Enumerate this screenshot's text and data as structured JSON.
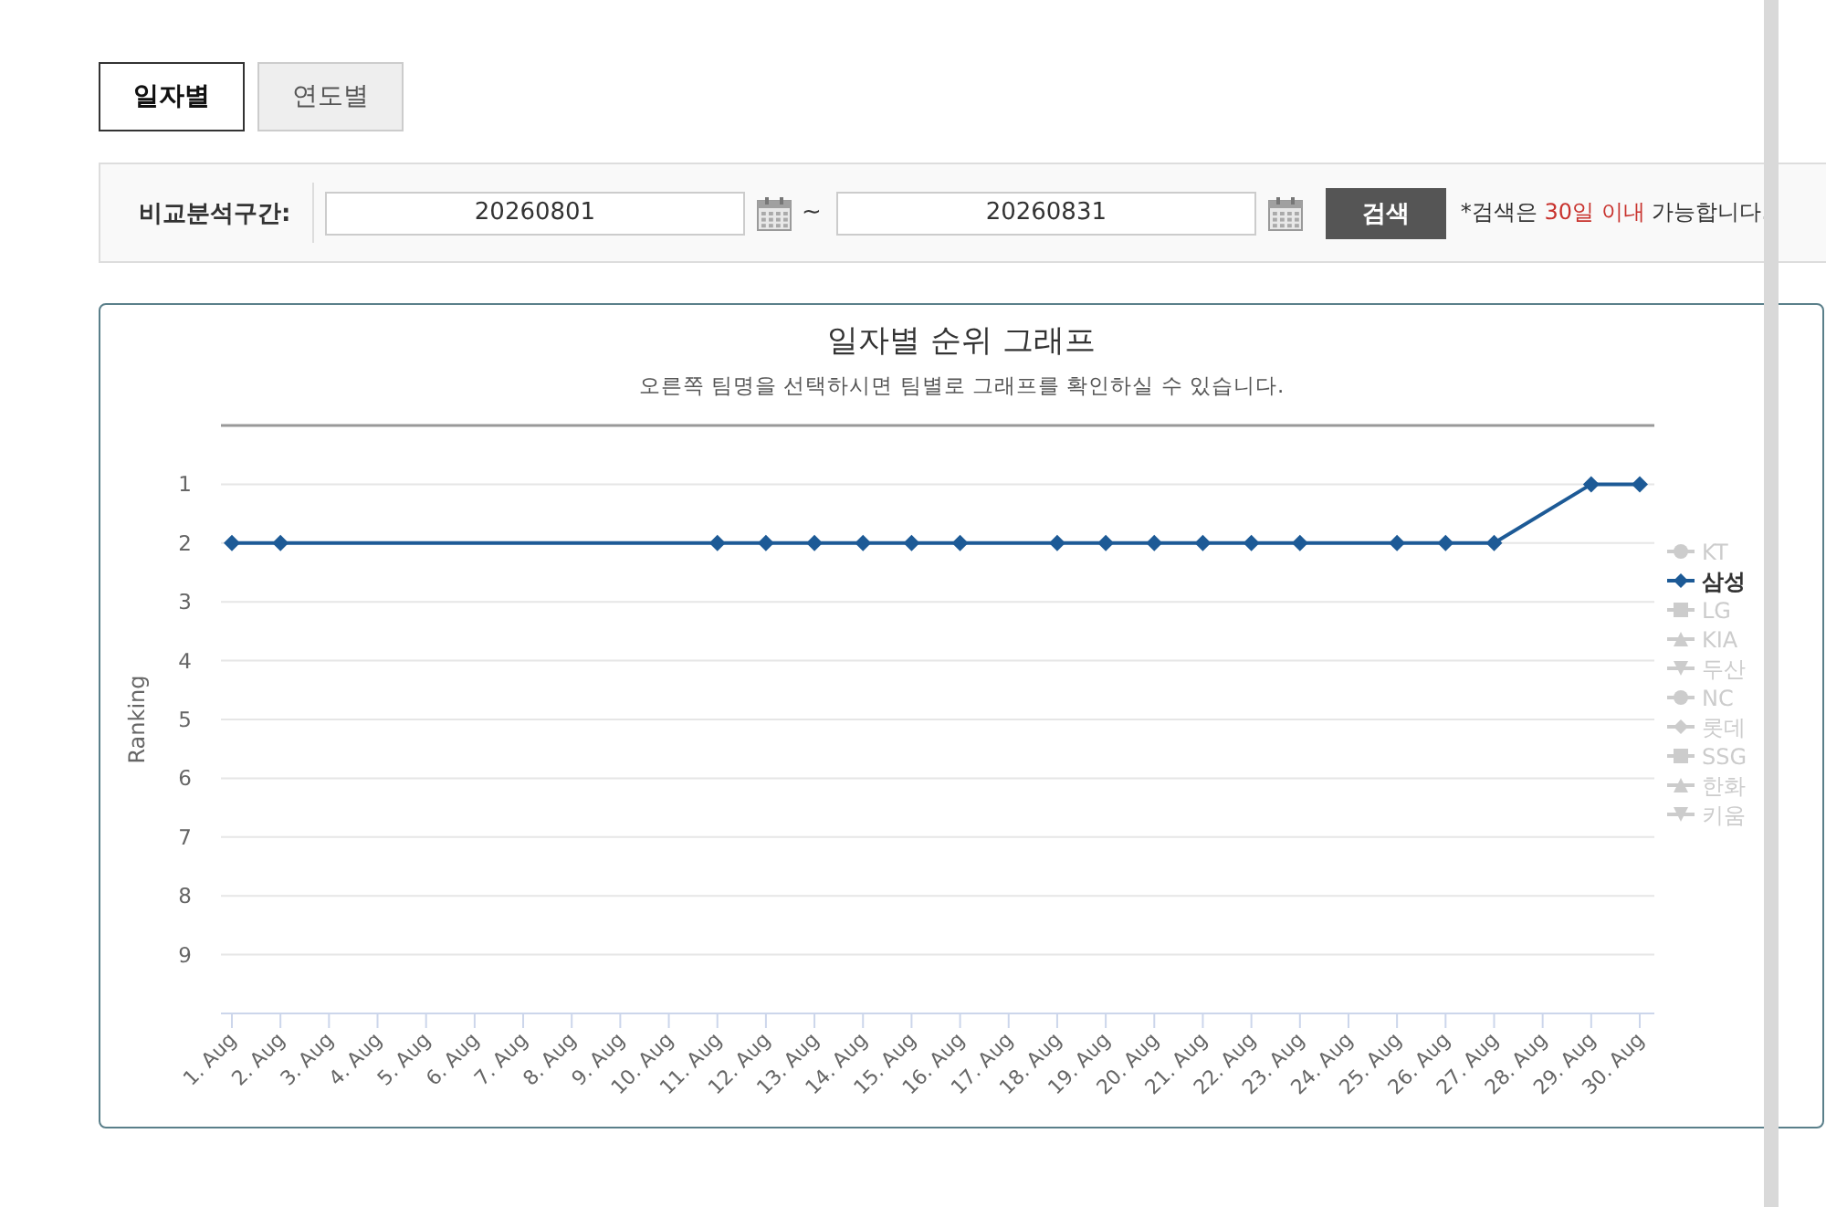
{
  "tabs": [
    {
      "label": "일자별",
      "selected": true
    },
    {
      "label": "연도별",
      "selected": false
    }
  ],
  "filter": {
    "label": "비교분석구간:",
    "start": "20260801",
    "separator": "~",
    "end": "20260831",
    "button": "검색",
    "note_prefix": "*검색은 ",
    "note_highlight": "30일 이내",
    "note_suffix": " 가능합니다."
  },
  "graph": {
    "title": "일자별 순위 그래프",
    "subtitle": "오른쪽 팀명을 선택하시면 팀별로 그래프를 확인하실 수 있습니다.",
    "chart_data": {
      "type": "line",
      "ylabel": "Ranking",
      "ylim": [
        10,
        0
      ],
      "yticks": [
        1,
        2,
        3,
        4,
        5,
        6,
        7,
        8,
        9
      ],
      "categories": [
        "1. Aug",
        "2. Aug",
        "3. Aug",
        "4. Aug",
        "5. Aug",
        "6. Aug",
        "7. Aug",
        "8. Aug",
        "9. Aug",
        "10. Aug",
        "11. Aug",
        "12. Aug",
        "13. Aug",
        "14. Aug",
        "15. Aug",
        "16. Aug",
        "17. Aug",
        "18. Aug",
        "19. Aug",
        "20. Aug",
        "21. Aug",
        "22. Aug",
        "23. Aug",
        "24. Aug",
        "25. Aug",
        "26. Aug",
        "27. Aug",
        "28. Aug",
        "29. Aug",
        "30. Aug"
      ],
      "grid": true,
      "legend": true,
      "series": [
        {
          "name": "삼성",
          "color": "#1d5a96",
          "marker": "diamond",
          "values": [
            2,
            2,
            null,
            null,
            null,
            null,
            null,
            null,
            null,
            null,
            2,
            2,
            2,
            2,
            2,
            2,
            null,
            2,
            2,
            2,
            2,
            2,
            2,
            null,
            2,
            2,
            2,
            null,
            1,
            1
          ]
        }
      ]
    },
    "legend": [
      {
        "label": "KT",
        "kind": "circle",
        "selected": false
      },
      {
        "kind": "diamond",
        "selected": true
      },
      {
        "label": "LG",
        "kind": "square",
        "selected": false
      },
      {
        "label": "KIA",
        "kind": "triangle",
        "selected": false
      },
      {
        "label": "두산",
        "kind": "triangle-down",
        "selected": false
      },
      {
        "label": "NC",
        "kind": "circle",
        "selected": false
      },
      {
        "label": "롯데",
        "kind": "diamond",
        "selected": false
      },
      {
        "label": "SSG",
        "kind": "square",
        "selected": false
      },
      {
        "label": "한화",
        "kind": "triangle",
        "selected": false
      },
      {
        "label": "키움",
        "kind": "triangle-down",
        "selected": false
      }
    ]
  }
}
